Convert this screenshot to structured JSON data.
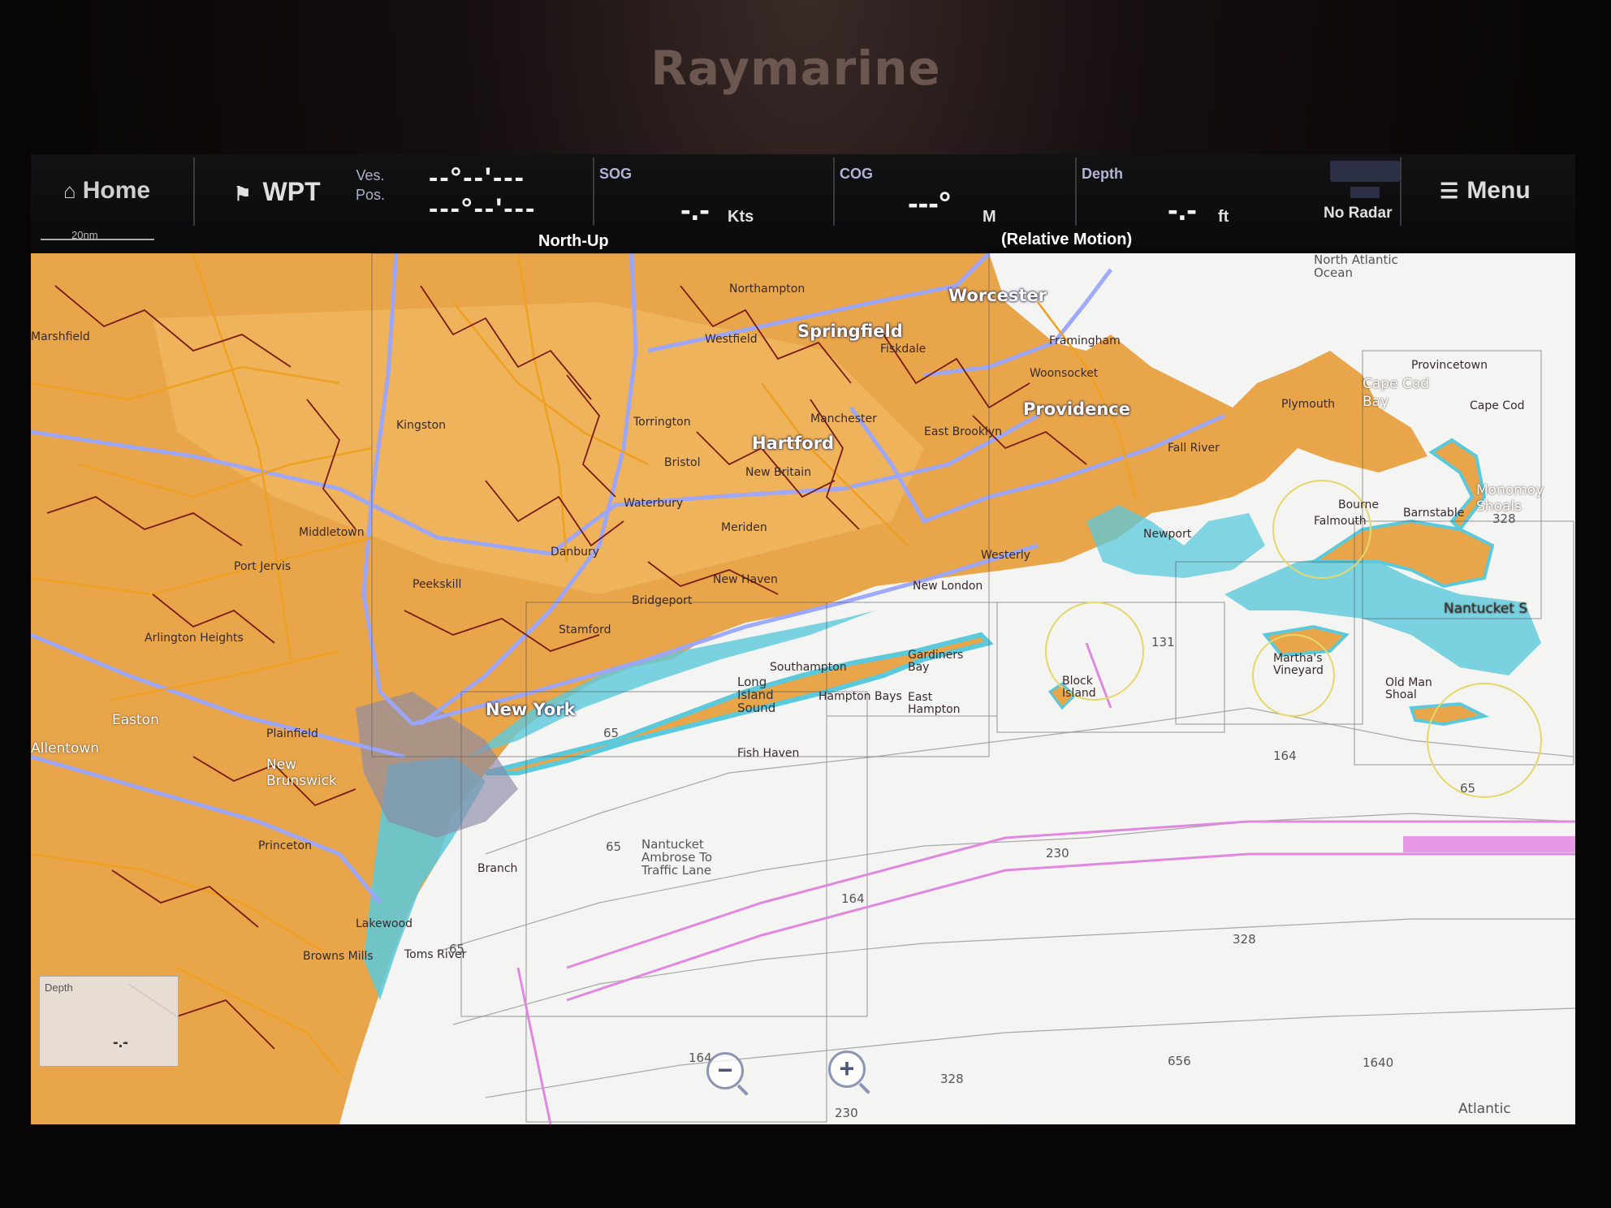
{
  "device": {
    "brand": "Raymarine"
  },
  "topbar": {
    "home_label": "Home",
    "home_icon": "home-icon",
    "scale_label": "20nm",
    "wpt_label": "WPT",
    "wpt_icon": "waypoint-flag-icon",
    "vespos_label_1": "Ves.",
    "vespos_label_2": "Pos.",
    "vespos_line_1": "--°--'---",
    "vespos_line_2": "---°--'---",
    "sog_label": "SOG",
    "sog_value": "-.-",
    "sog_unit": "Kts",
    "cog_label": "COG",
    "cog_value": "---°",
    "cog_unit": "M",
    "depth_label": "Depth",
    "depth_value": "-.-",
    "depth_unit": "ft",
    "radar_status": "No Radar",
    "orientation_mode": "North-Up",
    "motion_mode": "(Relative Motion)",
    "menu_label": "Menu",
    "menu_icon": "menu-lines-icon"
  },
  "map": {
    "cities_big": [
      "Worcester",
      "Springfield",
      "Providence",
      "Hartford",
      "New York"
    ],
    "cities_med": [
      "Easton",
      "Allentown",
      "New Brunswick",
      "Cape Cod Bay",
      "Monomoy Shoals",
      "Nantucket S"
    ],
    "towns": [
      "Northampton",
      "Westfield",
      "Fiskdale",
      "Framingham",
      "Woonsocket",
      "East Brooklyn",
      "Fall River",
      "Manchester",
      "Torrington",
      "Bristol",
      "New Britain",
      "Waterbury",
      "Meriden",
      "Danbury",
      "Port Jervis",
      "Peekskill",
      "Middletown",
      "Bridgeport",
      "Stamford",
      "Westerly",
      "New London",
      "New Haven",
      "Newport",
      "Falmouth",
      "Plainfield",
      "Princeton",
      "Branch",
      "Lakewood",
      "Toms River",
      "Browns Mills",
      "Arlington Heights",
      "Marshfield",
      "Provincetown",
      "Cape Cod",
      "Bourne",
      "Barnstable",
      "Plymouth",
      "Kingston",
      "Southampton",
      "Hampton Bays",
      "Fish Haven",
      "Old Man Shoal",
      "Martha's Vineyard",
      "Block Island",
      "Gardiners Bay",
      "East Hampton",
      "Long Island Sound",
      "Nantucket Ambrose To Traffic Lane",
      "North Atlantic Ocean"
    ],
    "depth_contours": [
      "65",
      "65",
      "65",
      "65",
      "131",
      "164",
      "164",
      "164",
      "230",
      "230",
      "328",
      "328",
      "328",
      "656",
      "1640"
    ],
    "ocean_label": "Atlantic",
    "depth_panel_label": "Depth",
    "depth_panel_value": "-.-",
    "zoom_out_label": "−",
    "zoom_in_label": "+"
  },
  "colors": {
    "land": "#e8a54a",
    "land_light": "#f1bd67",
    "shallow_water": "#5bc9dc",
    "deep_water": "#f4f4f2",
    "major_road": "#9aa6ff",
    "minor_road": "#7a1a12",
    "secondary_road": "#f0a020",
    "traffic_lane": "#e088e0",
    "topbar_bg": "#0b0b0c"
  }
}
